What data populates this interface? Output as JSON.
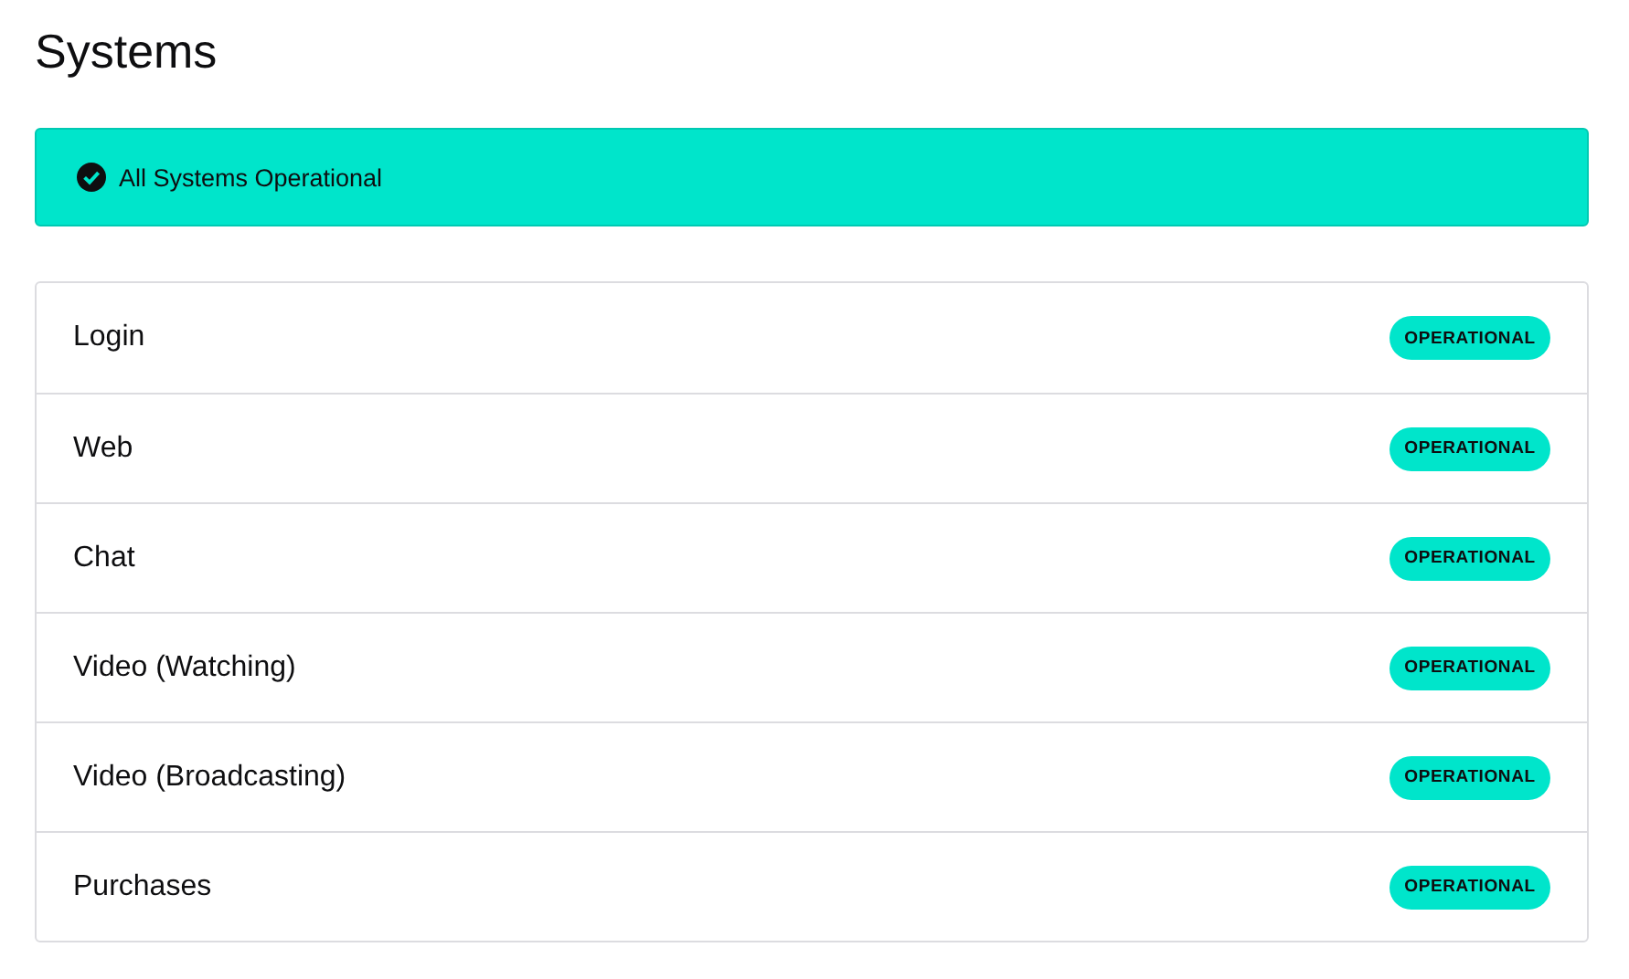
{
  "title": "Systems",
  "banner": {
    "text": "All Systems Operational"
  },
  "systems": [
    {
      "name": "Login",
      "status": "OPERATIONAL"
    },
    {
      "name": "Web",
      "status": "OPERATIONAL"
    },
    {
      "name": "Chat",
      "status": "OPERATIONAL"
    },
    {
      "name": "Video (Watching)",
      "status": "OPERATIONAL"
    },
    {
      "name": "Video (Broadcasting)",
      "status": "OPERATIONAL"
    },
    {
      "name": "Purchases",
      "status": "OPERATIONAL"
    }
  ]
}
